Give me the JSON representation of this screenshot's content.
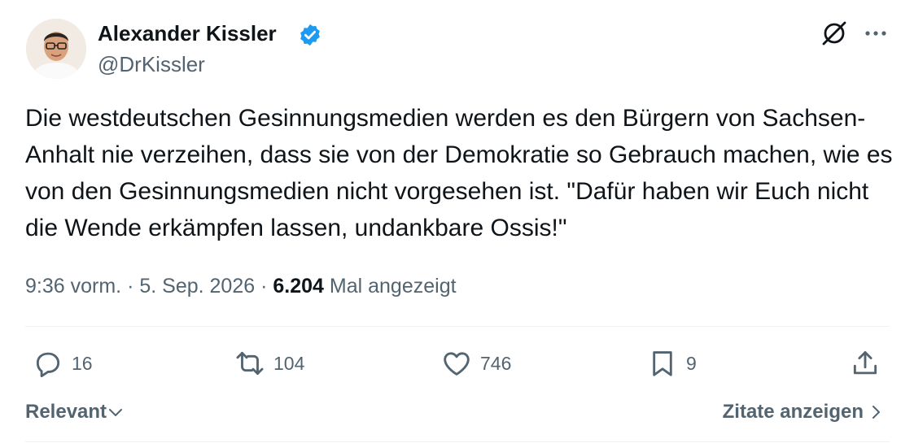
{
  "author": {
    "name": "Alexander Kissler",
    "handle": "@DrKissler"
  },
  "tweet": {
    "text": "Die westdeutschen Gesinnungsmedien werden es den Bürgern von Sachsen-Anhalt nie verzeihen, dass sie von der Demokratie so Gebrauch machen, wie es von den Gesinnungsmedien nicht vorgesehen ist. \"Dafür haben wir Euch nicht die Wende erkämpfen lassen, undankbare Ossis!\"",
    "time": "9:36 vorm.",
    "date": "5. Sep. 2026",
    "sep": "·",
    "views": "6.204",
    "views_label": "Mal angezeigt"
  },
  "actions": {
    "replies": "16",
    "reposts": "104",
    "likes": "746",
    "bookmarks": "9"
  },
  "footer": {
    "sort_label": "Relevant",
    "quotes_label": "Zitate anzeigen"
  },
  "colors": {
    "text": "#0f1419",
    "secondary": "#536471",
    "verified": "#1d9bf0",
    "divider": "#eff3f4"
  },
  "icons": [
    "verified-badge-icon",
    "grok-icon",
    "more-icon",
    "reply-icon",
    "repost-icon",
    "like-icon",
    "bookmark-icon",
    "share-icon",
    "chevron-down-icon",
    "chevron-right-icon"
  ]
}
